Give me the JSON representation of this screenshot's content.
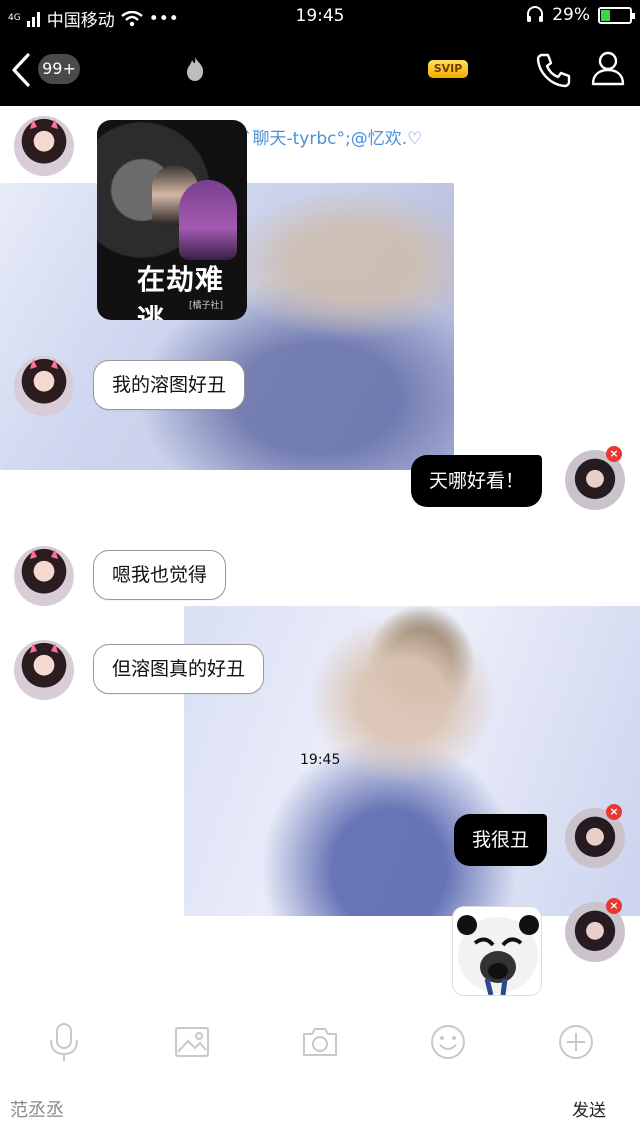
{
  "status_bar": {
    "network": "4G",
    "carrier": "中国移动",
    "dots": "•••",
    "time": "19:45",
    "battery_percent": "29%",
    "battery_level": 0.29
  },
  "header": {
    "unread_badge": "99+",
    "svip_label": "SVIP"
  },
  "chat": {
    "sender_name": "互赞`聊天-tyrbc°;@忆欢.♡",
    "poster_title": "在劫难逃",
    "poster_sub": "[橘子社]",
    "messages": [
      {
        "side": "in",
        "text": "我的溶图好丑"
      },
      {
        "side": "out",
        "text": "天哪好看！"
      },
      {
        "side": "in",
        "text": "嗯我也觉得"
      },
      {
        "side": "in",
        "text": "但溶图真的好丑"
      },
      {
        "side": "out",
        "text": "我很丑"
      }
    ],
    "timestamp": "19:45",
    "delete_mark": "×"
  },
  "input": {
    "value": "范丞丞",
    "send_label": "发送"
  },
  "icons": {
    "back": "chevron-left-icon",
    "flame": "flame-icon",
    "phone": "phone-icon",
    "profile": "person-icon",
    "mic": "microphone-icon",
    "image": "image-icon",
    "camera": "camera-icon",
    "emoji": "emoji-icon",
    "plus": "plus-icon"
  },
  "colors": {
    "sender_name": "#4a90d9",
    "out_bubble": "#000000",
    "svip": "#f2a900",
    "delete_badge": "#e53935",
    "battery": "#3ed24d"
  }
}
